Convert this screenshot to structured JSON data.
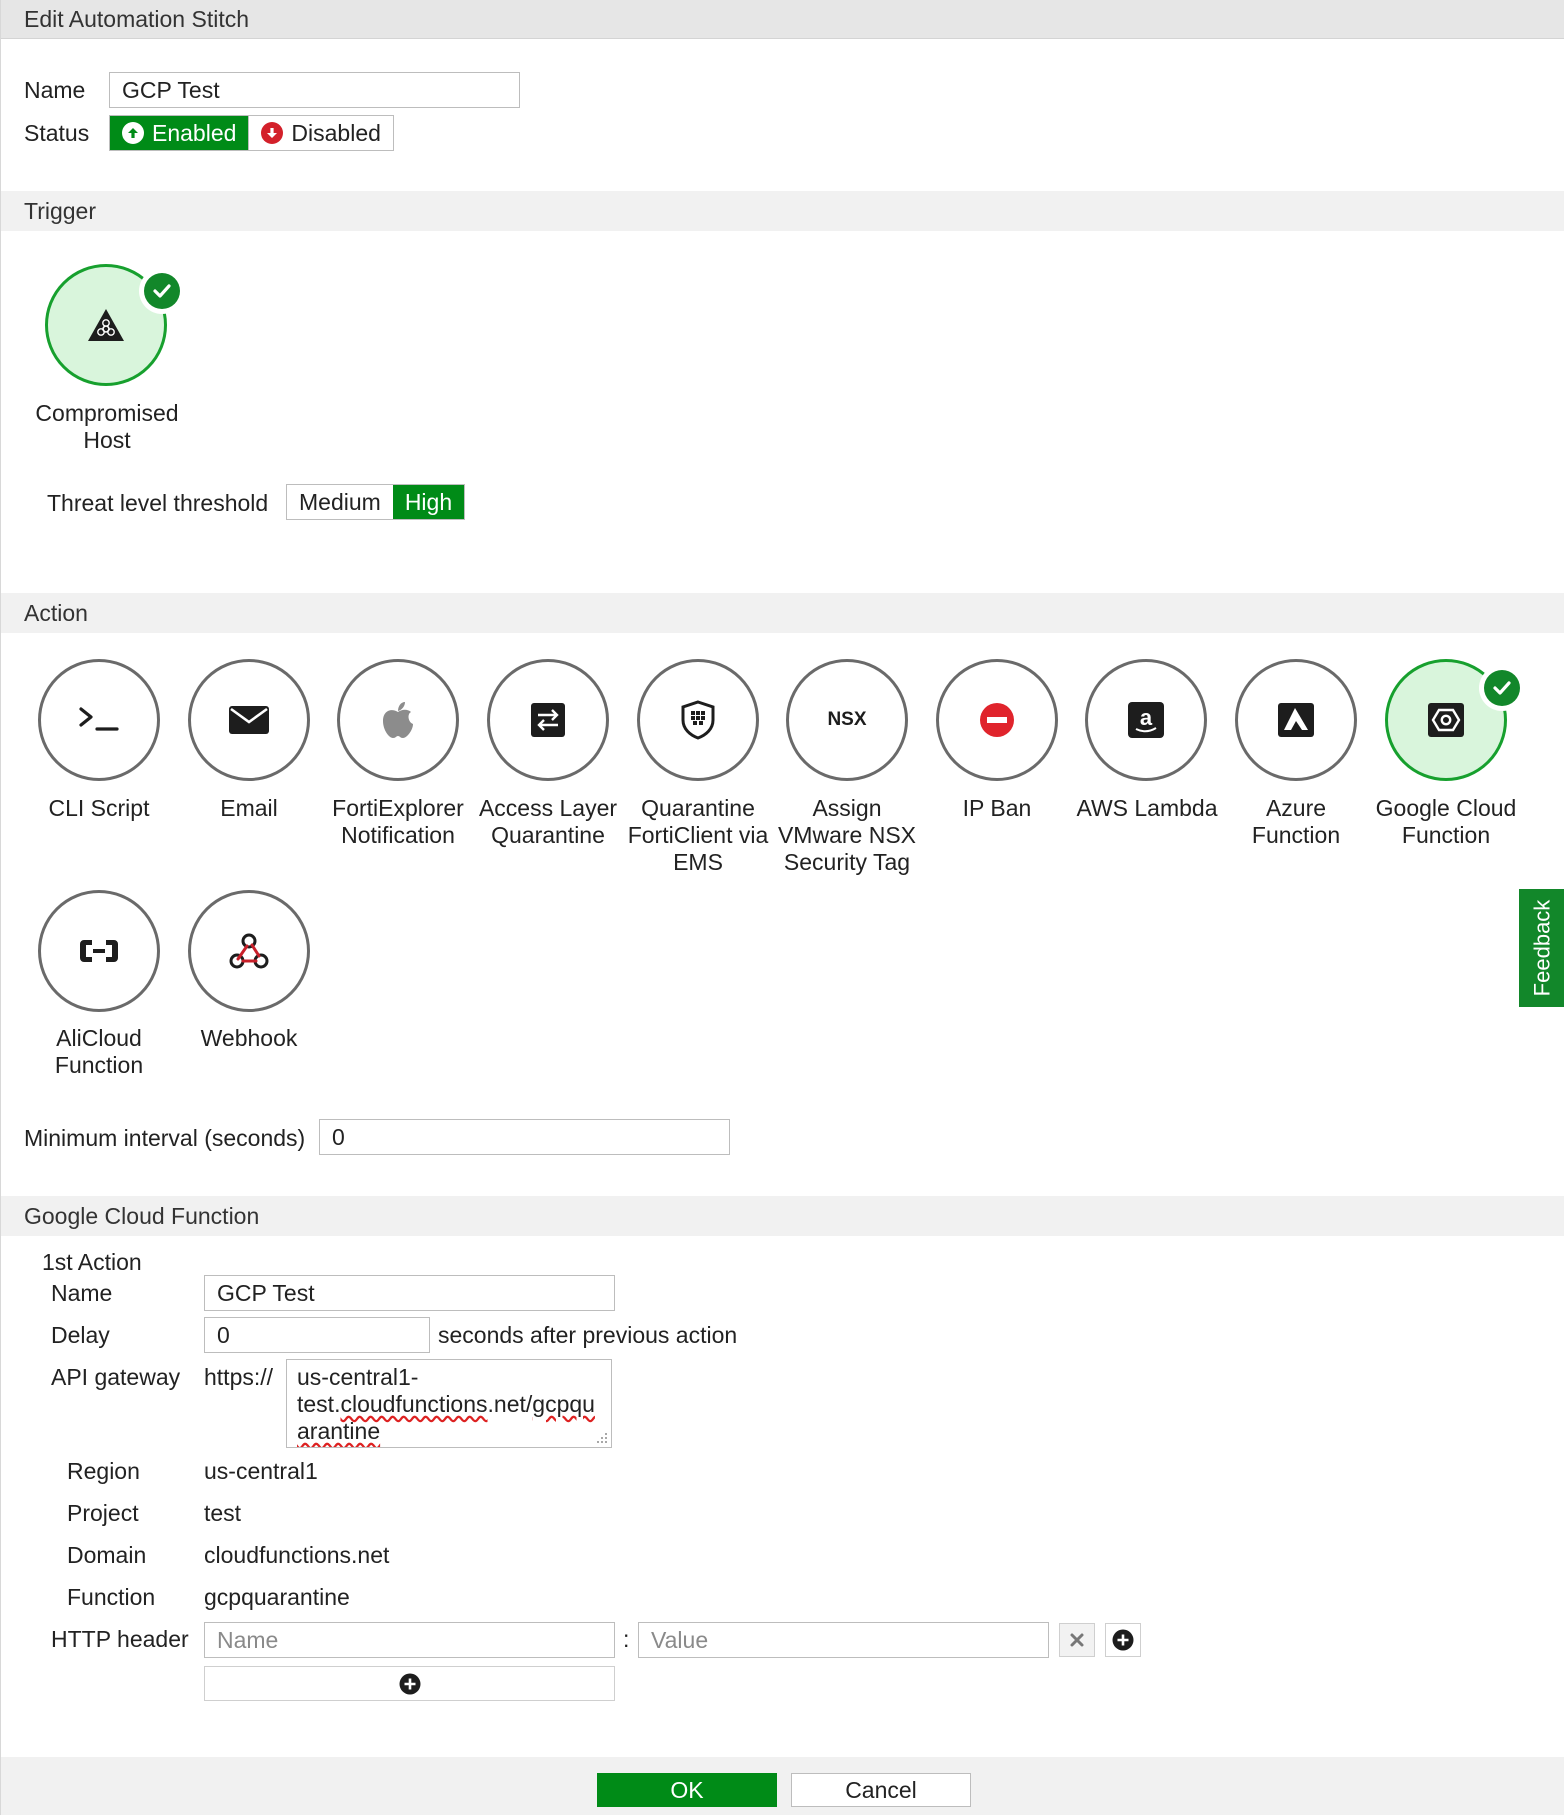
{
  "window": {
    "title": "Edit Automation Stitch"
  },
  "general": {
    "name_label": "Name",
    "name_value": "GCP Test",
    "status_label": "Status",
    "status_enabled": "Enabled",
    "status_disabled": "Disabled"
  },
  "trigger": {
    "header": "Trigger",
    "selected_label": "Compromised Host",
    "threshold_label": "Threat level threshold",
    "threshold_options": [
      "Medium",
      "High"
    ],
    "threshold_selected": "High"
  },
  "action": {
    "header": "Action",
    "items": [
      {
        "label": "CLI Script",
        "icon": "terminal-icon"
      },
      {
        "label": "Email",
        "icon": "envelope-icon"
      },
      {
        "label": "FortiExplorer Notification",
        "icon": "apple-icon"
      },
      {
        "label": "Access Layer Quarantine",
        "icon": "swap-icon"
      },
      {
        "label": "Quarantine FortiClient via EMS",
        "icon": "shield-icon"
      },
      {
        "label": "Assign VMware NSX Security Tag",
        "icon": "nsx-icon",
        "icon_text": "NSX"
      },
      {
        "label": "IP Ban",
        "icon": "no-entry-icon"
      },
      {
        "label": "AWS Lambda",
        "icon": "amazon-icon"
      },
      {
        "label": "Azure Function",
        "icon": "azure-icon"
      },
      {
        "label": "Google Cloud Function",
        "icon": "gcp-icon",
        "selected": true
      },
      {
        "label": "AliCloud Function",
        "icon": "alicloud-icon"
      },
      {
        "label": "Webhook",
        "icon": "webhook-icon"
      }
    ],
    "min_interval_label": "Minimum interval (seconds)",
    "min_interval_value": "0"
  },
  "gcf": {
    "header": "Google Cloud Function",
    "action_title": "1st Action",
    "name_label": "Name",
    "name_value": "GCP Test",
    "delay_label": "Delay",
    "delay_value": "0",
    "delay_suffix": "seconds after previous action",
    "api_label": "API gateway",
    "api_prefix": "https://",
    "api_value_line1": "us-central1-",
    "api_value_line2": "test.",
    "api_value_line2b": "cloudfunctions",
    "api_value_line2c": ".net/",
    "api_value_line2d": "gcpqu",
    "api_value_line3": "arantine",
    "region_label": "Region",
    "region_value": "us-central1",
    "project_label": "Project",
    "project_value": "test",
    "domain_label": "Domain",
    "domain_value": "cloudfunctions.net",
    "function_label": "Function",
    "function_value": "gcpquarantine",
    "http_label": "HTTP header",
    "http_name_placeholder": "Name",
    "http_value_placeholder": "Value",
    "http_separator": ":"
  },
  "footer": {
    "ok": "OK",
    "cancel": "Cancel"
  },
  "feedback": "Feedback",
  "colors": {
    "accent": "#008b17",
    "selected_bg": "#d9f5dc",
    "header_bg": "#f1f1f1"
  }
}
